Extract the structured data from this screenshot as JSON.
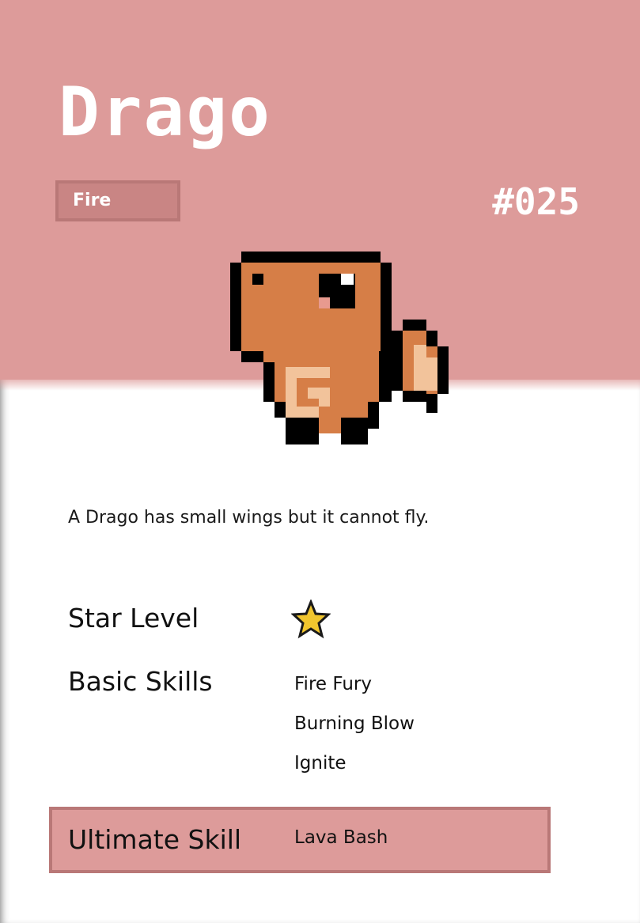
{
  "creature": {
    "name": "Drago",
    "type": "Fire",
    "number": "#025",
    "sprite": "orange-pixel-creature",
    "description": "A Drago has small wings but it cannot fly."
  },
  "stats": {
    "star_label": "Star Level",
    "star_count": 1,
    "star_icon": "star-icon",
    "basic_label": "Basic Skills",
    "basic_skills": [
      "Fire Fury",
      "Burning Blow",
      "Ignite"
    ],
    "ultimate_label": "Ultimate Skill",
    "ultimate_skill": "Lava Bash"
  },
  "colors": {
    "band": "#dd9b9a",
    "badge": "#c98584",
    "border": "#b97877",
    "body": "#d67e47",
    "belly": "#f2c39b"
  }
}
